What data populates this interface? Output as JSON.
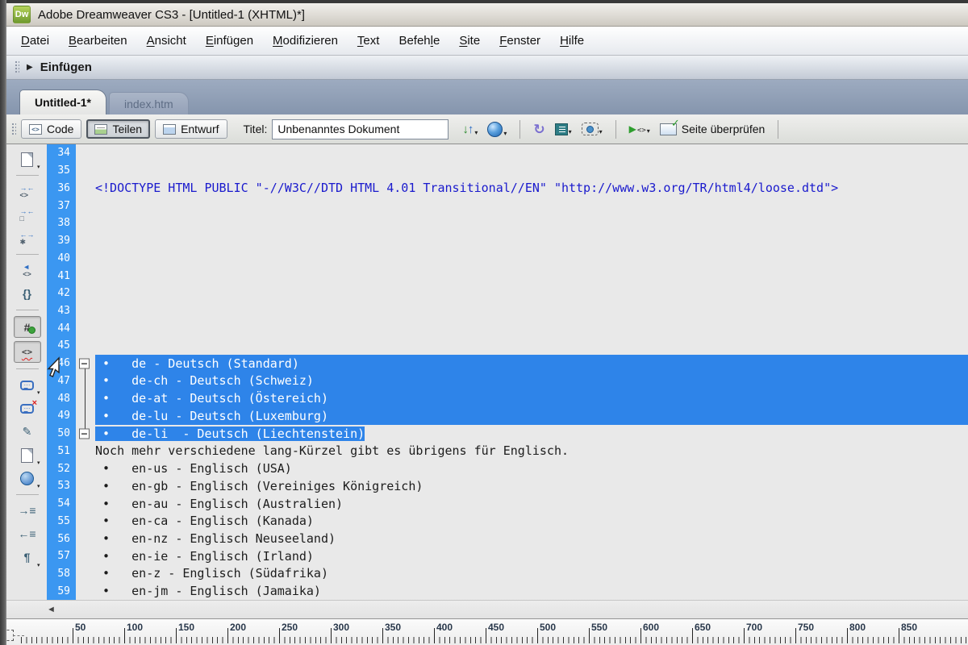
{
  "window": {
    "title": "Adobe Dreamweaver CS3 - [Untitled-1 (XHTML)*]",
    "app_icon_text": "Dw"
  },
  "menu": {
    "items": [
      {
        "label": "Datei",
        "mnemonic_index": 0
      },
      {
        "label": "Bearbeiten",
        "mnemonic_index": 0
      },
      {
        "label": "Ansicht",
        "mnemonic_index": 0
      },
      {
        "label": "Einfügen",
        "mnemonic_index": 0
      },
      {
        "label": "Modifizieren",
        "mnemonic_index": 0
      },
      {
        "label": "Text",
        "mnemonic_index": 0
      },
      {
        "label": "Befehle",
        "mnemonic_index": 5
      },
      {
        "label": "Site",
        "mnemonic_index": 0
      },
      {
        "label": "Fenster",
        "mnemonic_index": 0
      },
      {
        "label": "Hilfe",
        "mnemonic_index": 0
      }
    ]
  },
  "insert_bar": {
    "label": "Einfügen",
    "collapse_arrow": "▶"
  },
  "tabs": [
    {
      "label": "Untitled-1*",
      "active": true
    },
    {
      "label": "index.htm",
      "active": false
    }
  ],
  "toolbar": {
    "view_buttons": [
      {
        "label": "Code",
        "icon": "code-view-icon",
        "active": false
      },
      {
        "label": "Teilen",
        "icon": "split-view-icon",
        "active": true
      },
      {
        "label": "Entwurf",
        "icon": "design-view-icon",
        "active": false
      }
    ],
    "title_label": "Titel:",
    "title_value": "Unbenanntes Dokument",
    "check_page_label": "Seite überprüfen",
    "icon_glyphs": {
      "file-management-down": "↓",
      "file-management-up": "↑",
      "refresh": "↻",
      "validate-play": "▶",
      "validate-tag": "<>",
      "dropdown-caret": "▾"
    }
  },
  "coding_toolbar": {
    "items": [
      {
        "name": "open-documents",
        "icon": "page",
        "caret": true,
        "sep_after": true
      },
      {
        "name": "collapse-full-tag",
        "icon": "tworow",
        "glyph_top": "→←",
        "glyph_bottom": "<>"
      },
      {
        "name": "collapse-selection",
        "icon": "tworow",
        "glyph_top": "→←",
        "glyph_bottom": "□"
      },
      {
        "name": "expand-all",
        "icon": "tworow",
        "glyph_top": "←→",
        "glyph_bottom": "✱",
        "sep_after": true
      },
      {
        "name": "select-parent-tag",
        "icon": "tworow",
        "glyph_top": "◄",
        "glyph_bottom": "<>"
      },
      {
        "name": "balance-braces",
        "icon": "glyph",
        "glyph": "{}",
        "sep_after": true
      },
      {
        "name": "line-numbers",
        "icon": "hash",
        "glyph": "#",
        "pressed": true
      },
      {
        "name": "highlight-invalid-code",
        "icon": "invalid",
        "glyph": "<>",
        "pressed": true,
        "sep_after": true
      },
      {
        "name": "apply-comment",
        "icon": "bubble",
        "glyph": "···",
        "caret": true
      },
      {
        "name": "remove-comment",
        "icon": "bubble-x",
        "glyph": "···",
        "glyph2": "×"
      },
      {
        "name": "wrap-tag",
        "icon": "glyph",
        "glyph": "✎"
      },
      {
        "name": "recent-snippets",
        "icon": "page",
        "caret": true
      },
      {
        "name": "move-css",
        "icon": "circle",
        "caret": true,
        "sep_after": true
      },
      {
        "name": "indent-code",
        "icon": "glyph",
        "glyph": "→≡"
      },
      {
        "name": "outdent-code",
        "icon": "glyph",
        "glyph": "←≡"
      },
      {
        "name": "format-source-code",
        "icon": "glyph",
        "glyph": "¶",
        "caret": true
      }
    ]
  },
  "editor": {
    "lines": [
      {
        "num": 34,
        "text": ""
      },
      {
        "num": 35,
        "text": ""
      },
      {
        "num": 36,
        "text": "<!DOCTYPE HTML PUBLIC \"-//W3C//DTD HTML 4.01 Transitional//EN\" \"http://www.w3.org/TR/html4/loose.dtd\">",
        "syntax": "doctype"
      },
      {
        "num": 37,
        "text": ""
      },
      {
        "num": 38,
        "text": ""
      },
      {
        "num": 39,
        "text": ""
      },
      {
        "num": 40,
        "text": ""
      },
      {
        "num": 41,
        "text": ""
      },
      {
        "num": 42,
        "text": ""
      },
      {
        "num": 43,
        "text": ""
      },
      {
        "num": 44,
        "text": ""
      },
      {
        "num": 45,
        "text": ""
      },
      {
        "num": 46,
        "text": " •   de - Deutsch (Standard)",
        "selected": "full",
        "fold": "start"
      },
      {
        "num": 47,
        "text": " •   de-ch - Deutsch (Schweiz)",
        "selected": "full",
        "fold": "mid"
      },
      {
        "num": 48,
        "text": " •   de-at - Deutsch (Östereich)",
        "selected": "full",
        "fold": "mid"
      },
      {
        "num": 49,
        "text": " •   de-lu - Deutsch (Luxemburg)",
        "selected": "full",
        "fold": "mid"
      },
      {
        "num": 50,
        "text": " •   de-li  - Deutsch (Liechtenstein)",
        "selected": "text",
        "fold": "end"
      },
      {
        "num": 51,
        "text": "Noch mehr verschiedene lang-Kürzel gibt es übrigens für Englisch."
      },
      {
        "num": 52,
        "text": " •   en-us - Englisch (USA)"
      },
      {
        "num": 53,
        "text": " •   en-gb - Englisch (Vereiniges Königreich)"
      },
      {
        "num": 54,
        "text": " •   en-au - Englisch (Australien)"
      },
      {
        "num": 55,
        "text": " •   en-ca - Englisch (Kanada)"
      },
      {
        "num": 56,
        "text": " •   en-nz - Englisch Neuseeland)"
      },
      {
        "num": 57,
        "text": " •   en-ie - Englisch (Irland)"
      },
      {
        "num": 58,
        "text": " •   en-z - Englisch (Südafrika)"
      },
      {
        "num": 59,
        "text": " •   en-jm - Englisch (Jamaika)"
      }
    ],
    "fold_toggle_glyph": "−"
  },
  "ruler": {
    "labels": [
      "50",
      "100",
      "150",
      "200",
      "250",
      "300",
      "350",
      "400",
      "450",
      "500",
      "550",
      "600",
      "650",
      "700",
      "750",
      "800",
      "850"
    ]
  },
  "colors": {
    "gutter_blue": "#3b97f1",
    "selection_blue": "#2e84e9",
    "doctype_text": "#1a1acd",
    "app_icon_green": "#7ba23a"
  }
}
